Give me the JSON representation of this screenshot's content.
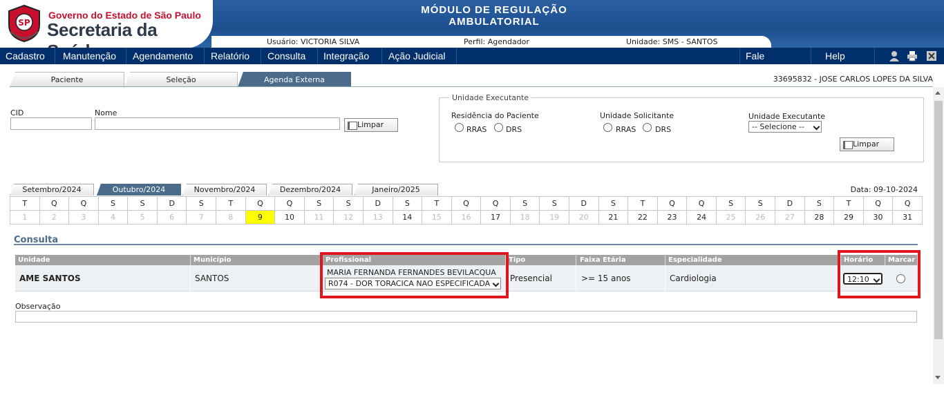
{
  "logo": {
    "line1": "Governo do Estado de São Paulo",
    "line2": "Secretaria da Saúde",
    "seal_text": "SP"
  },
  "module_title": [
    "MÓDULO DE REGULAÇÃO",
    "AMBULATORIAL"
  ],
  "userbar": {
    "usuario": "Usuário: VICTORIA SILVA",
    "perfil": "Perfil: Agendador",
    "unidade": "Unidade: SMS - SANTOS"
  },
  "menu": {
    "items": [
      "Cadastro",
      "Manutenção",
      "Agendamento",
      "Relatório",
      "Consulta",
      "Integração",
      "Ação Judicial"
    ],
    "right": [
      "Fale Conosco",
      "Help Desk"
    ],
    "icons": [
      "user-icon",
      "printer-icon",
      "close-icon"
    ]
  },
  "tabs": [
    "Paciente",
    "Seleção",
    "Agenda Externa"
  ],
  "active_tab": "Agenda Externa",
  "patient": "33695832 - JOSE CARLOS LOPES DA SILVA",
  "search": {
    "cid_label": "CID",
    "nome_label": "Nome",
    "cid_value": "",
    "nome_value": "",
    "limpar": "Limpar"
  },
  "unidade_executante": {
    "legend": "Unidade Executante",
    "residencia_label": "Residência do Paciente",
    "solicitante_label": "Unidade Solicitante",
    "executante_label": "Unidade Executante",
    "rras": "RRAS",
    "drs": "DRS",
    "select_value": "-- Selecione --",
    "limpar": "Limpar"
  },
  "months": [
    "Setembro/2024",
    "Outubro/2024",
    "Novembro/2024",
    "Dezembro/2024",
    "Janeiro/2025"
  ],
  "active_month": "Outubro/2024",
  "data_label": "Data: 09-10-2024",
  "calendar": {
    "weekdays": [
      "T",
      "Q",
      "Q",
      "S",
      "S",
      "D",
      "S",
      "T",
      "Q",
      "Q",
      "S",
      "S",
      "D",
      "S",
      "T",
      "Q",
      "Q",
      "S",
      "S",
      "D",
      "S",
      "T",
      "Q",
      "Q",
      "S",
      "S",
      "D",
      "S",
      "T",
      "Q",
      "Q"
    ],
    "days": [
      "1",
      "2",
      "3",
      "4",
      "5",
      "6",
      "7",
      "8",
      "9",
      "10",
      "11",
      "12",
      "13",
      "14",
      "15",
      "16",
      "17",
      "18",
      "19",
      "20",
      "21",
      "22",
      "23",
      "24",
      "25",
      "26",
      "27",
      "28",
      "29",
      "30",
      "31"
    ],
    "available": [
      "9",
      "10",
      "14",
      "17",
      "21",
      "22",
      "23",
      "24",
      "28",
      "29",
      "30",
      "31"
    ],
    "selected": "9"
  },
  "consulta": {
    "title": "Consulta",
    "headers": [
      "Unidade",
      "Município",
      "Profissional",
      "Tipo Atendimento",
      "Faixa Etária",
      "Especialidade",
      "Horário",
      "Marcar"
    ],
    "row": {
      "unidade": "AME SANTOS",
      "municipio": "SANTOS",
      "profissional": "MARIA FERNANDA FERNANDES BEVILACQUA",
      "procedimento": "R074 - DOR TORACICA NAO ESPECIFICADA",
      "tipo": "Presencial",
      "faixa": ">= 15 anos",
      "especialidade": "Cardiologia",
      "horario": "12:10"
    },
    "observacao_label": "Observação"
  },
  "colors": {
    "menu_bg": "#002f6c",
    "header_bg": "#1d4f8f",
    "active_tab": "#4a6b8a",
    "highlight": "#e0161f",
    "today": "#ffff00"
  }
}
